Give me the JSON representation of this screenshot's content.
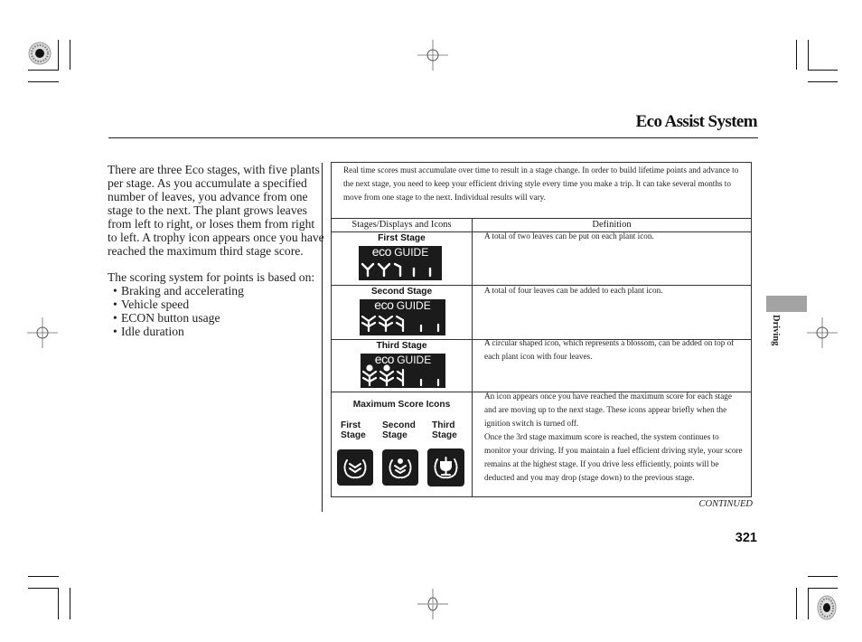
{
  "header": {
    "title": "Eco Assist System"
  },
  "intro_text": {
    "paragraph1": "There are three Eco stages, with five plants per stage. As you accumulate a specified number of leaves, you advance from one stage to the next. The plant grows leaves from left to right, or loses them from right to left. A trophy icon appears once you have reached the maximum third stage score.",
    "paragraph2": "The scoring system for points is based on:",
    "bullets": [
      "Braking and accelerating",
      "Vehicle speed",
      "ECON button usage",
      "Idle duration"
    ]
  },
  "table": {
    "note": "Real time scores must accumulate over time to result in a stage change. In order to build lifetime points and advance to the next stage, you need to keep your efficient driving style every time you make a trip. It can take several months to move from one stage to the next. Individual results will vary.",
    "columns": [
      "Stages/Displays and Icons",
      "Definition"
    ],
    "rows": [
      {
        "stage": "First Stage",
        "display": {
          "title_prefix": "eco",
          "title_suffix": " GUIDE",
          "icon": "two-leaf-plant-icons"
        },
        "definition": "A total of two leaves can be put on each plant icon."
      },
      {
        "stage": "Second Stage",
        "display": {
          "title_prefix": "eco",
          "title_suffix": " GUIDE",
          "icon": "four-leaf-plant-icons"
        },
        "definition": "A total of four leaves can be added to each plant icon."
      },
      {
        "stage": "Third Stage",
        "display": {
          "title_prefix": "eco",
          "title_suffix": " GUIDE",
          "icon": "blossom-plant-icons"
        },
        "definition": "A circular shaped icon, which represents a blossom, can be added on top of each plant icon with four leaves."
      }
    ],
    "max_score": {
      "title": "Maximum Score Icons",
      "stages": [
        {
          "line1": "First",
          "line2": "Stage",
          "icon": "laurel-two-leaf-icon"
        },
        {
          "line1": "Second",
          "line2": "Stage",
          "icon": "laurel-blossom-icon"
        },
        {
          "line1": "Third",
          "line2": "Stage",
          "icon": "laurel-trophy-icon"
        }
      ],
      "definition": "An icon appears once you have reached the maximum score for each stage and are moving up to the next stage. These icons appear briefly when the ignition switch is turned off.\nOnce the 3rd stage maximum score is reached, the system continues to monitor your driving. If you maintain a fuel efficient driving style, your score remains at the highest stage. If you drive less efficiently, points will be deducted and you may drop (stage down) to the previous stage."
    }
  },
  "footer": {
    "continued": "CONTINUED",
    "page_number": "321"
  },
  "side_tab": {
    "label": "Driving",
    "color": "#a3a3a3"
  }
}
